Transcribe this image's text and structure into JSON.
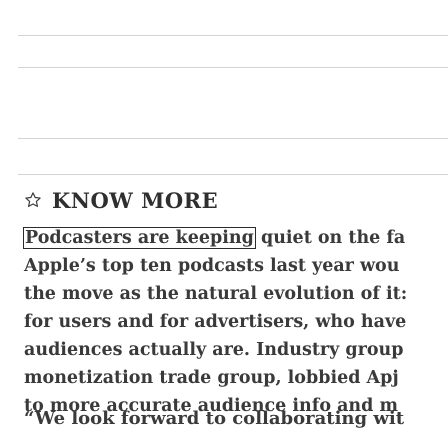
{
  "article": {
    "section_heading": "KNOW MORE",
    "heading_icon": "star-outline-icon",
    "paragraph": {
      "highlighted": "Podcasters are keeping",
      "line_1_rest": " quiet on the fa",
      "line_2": "Apple’s top ten podcasts last year wou",
      "line_3": "the move as the natural evolution of it:",
      "line_4": "for users and for advertisers, who have",
      "line_5": "audiences actually are. Industry group",
      "line_6": "monetization trade group, lobbied Apj",
      "line_7": "to more accurate audience info and m"
    },
    "quote_start": "“We look forward to collaborating wit"
  },
  "colors": {
    "text": "#3a3a3a",
    "rule": "#d4d4d4",
    "highlight_border": "#2b2b2b"
  }
}
